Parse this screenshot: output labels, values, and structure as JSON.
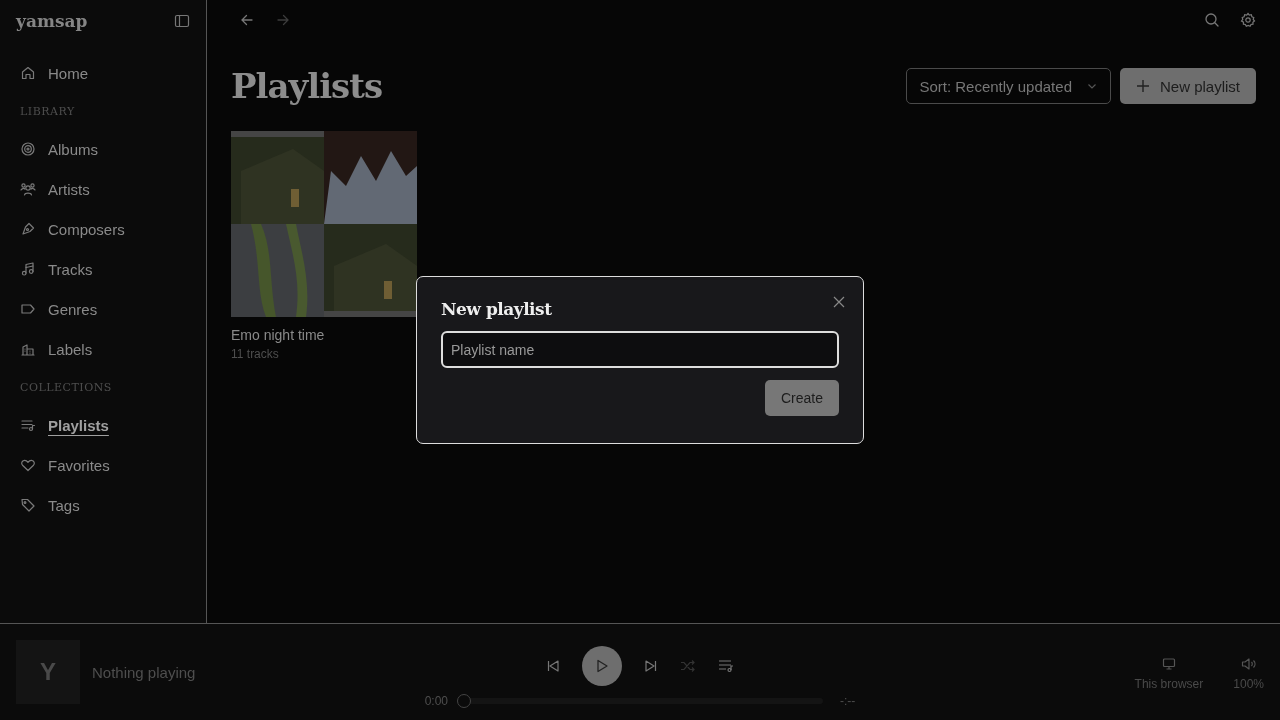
{
  "app": {
    "name": "yamsap"
  },
  "sidebar": {
    "items": [
      {
        "kind": "item",
        "label": "Home",
        "selected": false
      },
      {
        "kind": "heading",
        "label": "LIBRARY"
      },
      {
        "kind": "item",
        "label": "Albums",
        "selected": false
      },
      {
        "kind": "item",
        "label": "Artists",
        "selected": false
      },
      {
        "kind": "item",
        "label": "Composers",
        "selected": false
      },
      {
        "kind": "item",
        "label": "Tracks",
        "selected": false
      },
      {
        "kind": "item",
        "label": "Genres",
        "selected": false
      },
      {
        "kind": "item",
        "label": "Labels",
        "selected": false
      },
      {
        "kind": "heading",
        "label": "COLLECTIONS"
      },
      {
        "kind": "item",
        "label": "Playlists",
        "selected": true
      },
      {
        "kind": "item",
        "label": "Favorites",
        "selected": false
      },
      {
        "kind": "item",
        "label": "Tags",
        "selected": false
      }
    ]
  },
  "page": {
    "title": "Playlists",
    "sort": "Sort: Recently updated",
    "new_button": "New playlist"
  },
  "playlists": [
    {
      "name": "Emo night time",
      "count": "11 tracks"
    }
  ],
  "dialog": {
    "title": "New playlist",
    "placeholder": "Playlist name",
    "button": "Create"
  },
  "player": {
    "avatar": "Y",
    "status": "Nothing playing",
    "shuffle_disabled": true,
    "time": "0:00",
    "duration": "-:--",
    "level": 0,
    "device": "This browser",
    "volume": "100%"
  }
}
